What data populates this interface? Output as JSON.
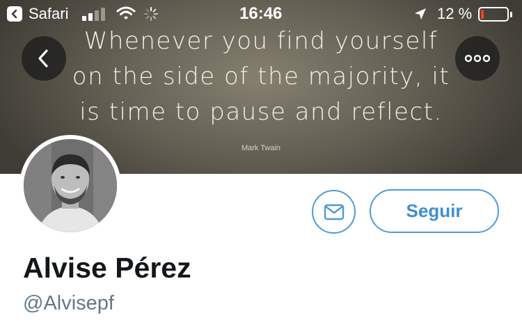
{
  "status_bar": {
    "back_app": "Safari",
    "time": "16:46",
    "battery_percent": "12 %",
    "battery_level": 0.12,
    "battery_color": "#ff3b30"
  },
  "header": {
    "quote_lines": [
      "Whenever you find yourself",
      "on the side of the majority, it",
      "is time to pause and reflect."
    ],
    "quote_author": "Mark Twain",
    "back_icon": "chevron-left-icon",
    "more_icon": "more-horizontal-icon"
  },
  "profile": {
    "display_name": "Alvise Pérez",
    "handle": "@Alvisepf",
    "follow_label": "Seguir",
    "message_icon": "envelope-icon",
    "accent_color": "#4e9bd6"
  }
}
